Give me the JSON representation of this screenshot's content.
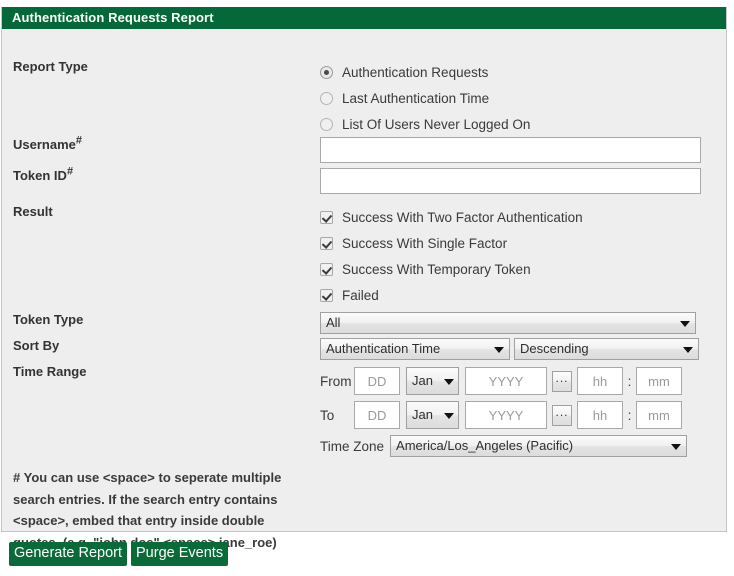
{
  "panel": {
    "title": "Authentication Requests Report"
  },
  "report_type": {
    "label": "Report Type",
    "options": [
      {
        "label": "Authentication Requests",
        "selected": true
      },
      {
        "label": "Last Authentication Time",
        "selected": false
      },
      {
        "label": "List Of Users Never Logged On",
        "selected": false
      }
    ]
  },
  "username": {
    "label": "Username",
    "marker": "#",
    "value": "",
    "placeholder": ""
  },
  "token_id": {
    "label": "Token ID",
    "marker": "#",
    "value": "",
    "placeholder": ""
  },
  "result": {
    "label": "Result",
    "options": [
      {
        "label": "Success With Two Factor Authentication",
        "checked": true
      },
      {
        "label": "Success With Single Factor",
        "checked": true
      },
      {
        "label": "Success With Temporary Token",
        "checked": true
      },
      {
        "label": "Failed",
        "checked": true
      }
    ]
  },
  "token_type": {
    "label": "Token Type",
    "selected": "All"
  },
  "sort_by": {
    "label": "Sort By",
    "field_selected": "Authentication Time",
    "order_selected": "Descending"
  },
  "time_range": {
    "label": "Time Range",
    "from": {
      "prefix": "From",
      "day_value": "",
      "day_placeholder": "DD",
      "month_selected": "Jan",
      "year_value": "",
      "year_placeholder": "YYYY",
      "picker_label": "...",
      "hour_value": "",
      "hour_placeholder": "hh",
      "separator": ":",
      "minute_value": "",
      "minute_placeholder": "mm"
    },
    "to": {
      "prefix": "To",
      "day_value": "",
      "day_placeholder": "DD",
      "month_selected": "Jan",
      "year_value": "",
      "year_placeholder": "YYYY",
      "picker_label": "...",
      "hour_value": "",
      "hour_placeholder": "hh",
      "separator": ":",
      "minute_value": "",
      "minute_placeholder": "mm"
    },
    "timezone": {
      "label": "Time Zone",
      "selected": "America/Los_Angeles (Pacific)"
    }
  },
  "footnote": {
    "line1": "# You can use <space> to seperate multiple",
    "line2": "search entries. If the search entry contains",
    "line3": "<space>, embed that entry inside double",
    "line4": "quotes. (e.g. \"john doe\" <space> jane_roe)"
  },
  "actions": {
    "generate_label": "Generate Report",
    "purge_label": "Purge Events"
  },
  "colors": {
    "header_green": "#056839",
    "button_green": "#0a6b38",
    "panel_bg": "#eeeeee",
    "panel_border": "#c6c6c6"
  }
}
